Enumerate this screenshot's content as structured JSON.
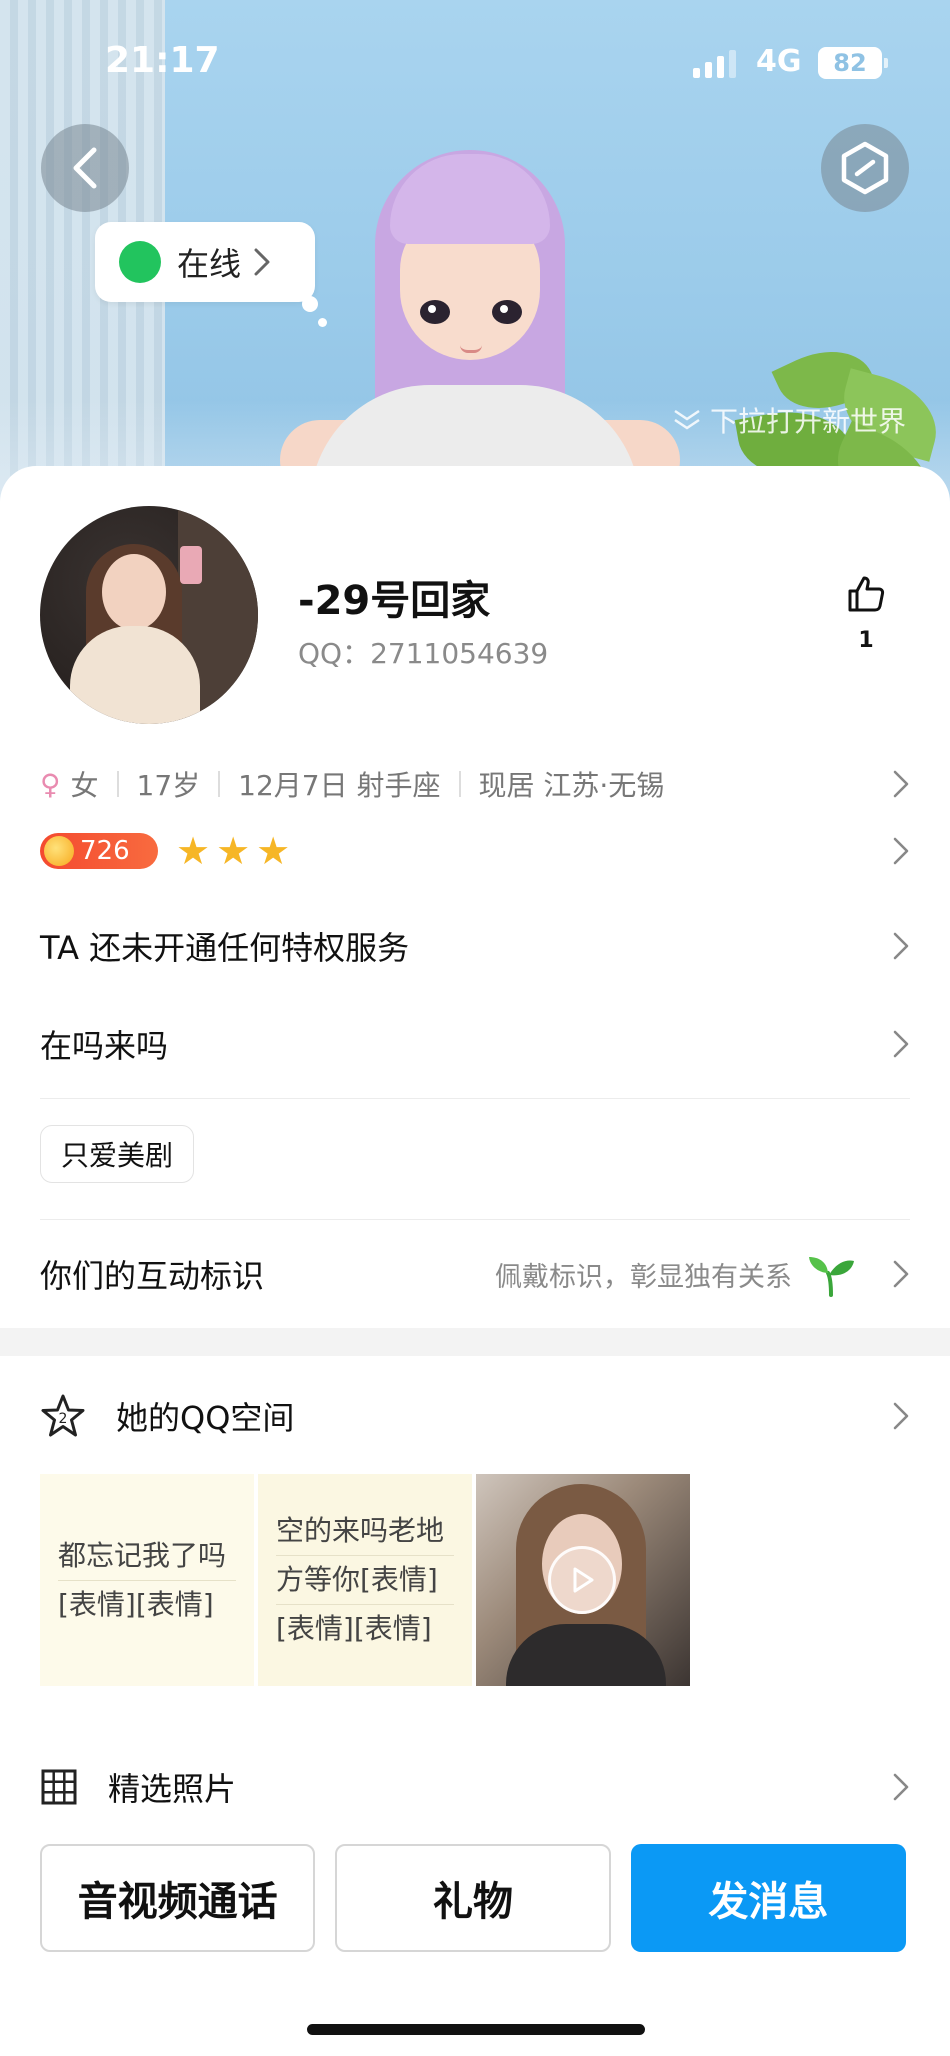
{
  "status_bar": {
    "time": "21:17",
    "network": "4G",
    "battery": "82"
  },
  "header": {
    "online_status": "在线",
    "pull_hint": "下拉打开新世界"
  },
  "profile": {
    "nickname": "-29号回家",
    "qq_label": "QQ：",
    "qq_number": "2711054639",
    "like_count": "1"
  },
  "info": {
    "gender": "女",
    "age": "17岁",
    "birthday": "12月7日 射手座",
    "location": "现居 江苏·无锡"
  },
  "level": {
    "value": "726",
    "stars": 3
  },
  "rows": {
    "privilege": "TA 还未开通任何特权服务",
    "signature": "在吗来吗",
    "tag": "只爱美剧",
    "interaction_label": "你们的互动标识",
    "interaction_hint": "佩戴标识，彰显独有关系"
  },
  "space": {
    "title": "她的QQ空间",
    "posts": [
      {
        "lines": [
          "都忘记我了吗",
          "[表情][表情]"
        ]
      },
      {
        "lines": [
          "空的来吗老地",
          "方等你[表情]",
          "[表情][表情]"
        ]
      }
    ]
  },
  "photos": {
    "title": "精选照片"
  },
  "actions": {
    "call": "音视频通话",
    "gift": "礼物",
    "message": "发消息"
  },
  "colors": {
    "accent": "#0b99f5",
    "online": "#22c45e",
    "level_badge": "#f44a2f",
    "star": "#f6b626"
  }
}
